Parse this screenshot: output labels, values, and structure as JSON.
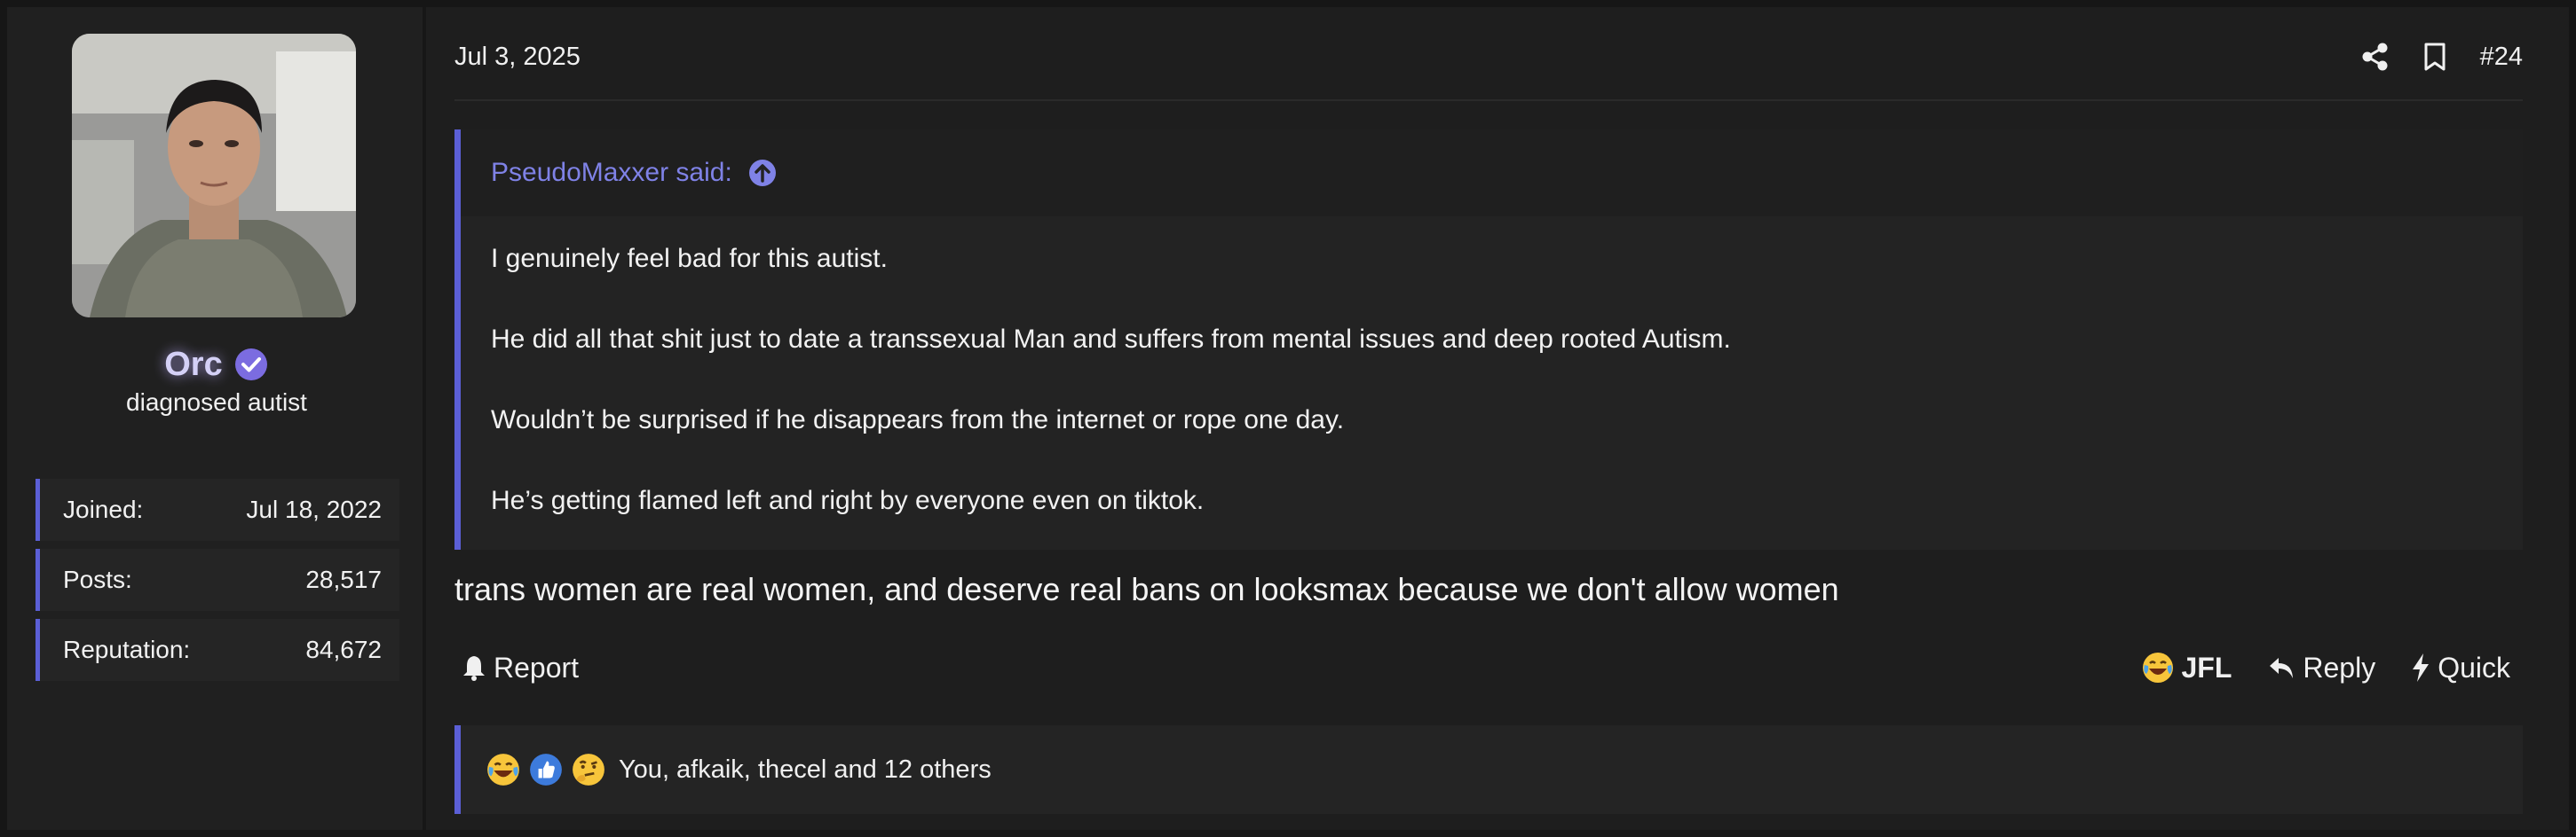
{
  "user": {
    "name": "Orc",
    "title": "diagnosed autist",
    "stats": [
      {
        "label": "Joined:",
        "value": "Jul 18, 2022"
      },
      {
        "label": "Posts:",
        "value": "28,517"
      },
      {
        "label": "Reputation:",
        "value": "84,672"
      }
    ],
    "name_color": "#d4d0f6"
  },
  "post": {
    "date": "Jul 3, 2025",
    "number": "#24",
    "quote": {
      "author_line": "PseudoMaxxer said:",
      "lines": [
        "I genuinely feel bad for this autist.",
        "He did all that shit just to date a transsexual Man and suffers from mental issues and deep rooted Autism.",
        "Wouldn’t be surprised if he disappears from the internet or rope one day.",
        "He’s getting flamed left and right by everyone even on tiktok."
      ]
    },
    "message": "trans women are real women, and deserve real bans on looksmax because we don't allow women"
  },
  "actions": {
    "report_label": "Report",
    "jfl_label": "JFL",
    "reply_label": "Reply",
    "quick_label": "Quick"
  },
  "reactions": {
    "text": "You, afkaik, thecel and 12 others",
    "icons": [
      "laughing-crying-emoji-icon",
      "thumbs-up-icon",
      "thinking-emoji-icon"
    ]
  },
  "icons": {
    "share": "share-icon",
    "bookmark": "bookmark-icon",
    "quote_jump": "arrow-up-circle-icon",
    "verified": "verified-check-icon",
    "report": "bell-icon",
    "reply": "reply-arrow-icon",
    "quick": "lightning-bolt-icon"
  },
  "colors": {
    "accent": "#5b5fd6",
    "quote_author": "#7f82e6",
    "background": "#1e1e1e"
  }
}
